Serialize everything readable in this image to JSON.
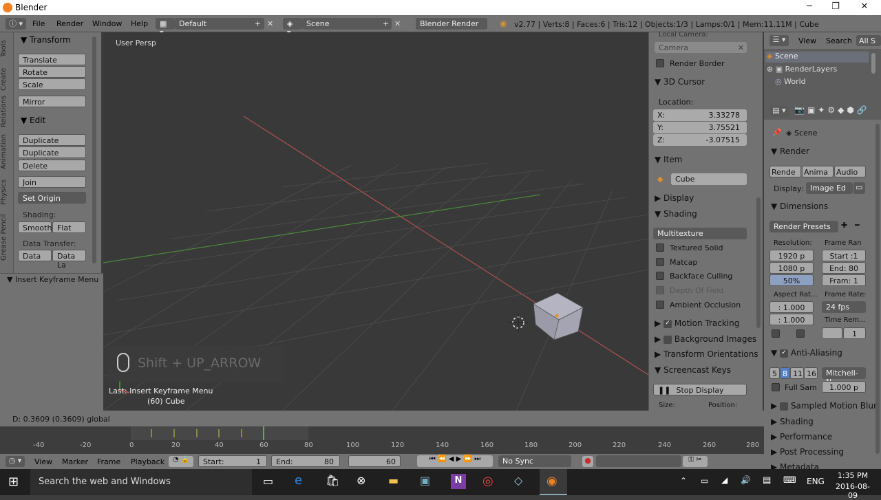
{
  "window": {
    "title": "Blender",
    "minimize": "─",
    "restore": "❐",
    "close": "✕"
  },
  "topbar": {
    "menus": [
      "File",
      "Render",
      "Window",
      "Help"
    ],
    "layout": "Default",
    "scene": "Scene",
    "engine": "Blender Render",
    "stats": "v2.77 | Verts:8 | Faces:6 | Tris:12 | Objects:1/3 | Lamps:0/1 | Mem:11.11M | Cube"
  },
  "vtabs": [
    "Tools",
    "Create",
    "Relations",
    "Animation",
    "Physics",
    "Grease Pencil"
  ],
  "tool": {
    "transform": "Transform",
    "translate": "Translate",
    "rotate": "Rotate",
    "scale": "Scale",
    "mirror": "Mirror",
    "edit": "Edit",
    "duplicate": "Duplicate",
    "duplicate_linked": "Duplicate Linked",
    "delete": "Delete",
    "join": "Join",
    "set_origin": "Set Origin",
    "shading": "Shading:",
    "smooth": "Smooth",
    "flat": "Flat",
    "data_transfer": "Data Transfer:",
    "data": "Data",
    "data_la": "Data La"
  },
  "redo": {
    "title": "Insert Keyframe Menu"
  },
  "viewport": {
    "persp": "User Persp",
    "screencast": "Shift + UP_ARROW",
    "last_op": "Last: Insert Keyframe Menu",
    "object": "(60) Cube"
  },
  "npanel": {
    "local_camera": "Local Camera:",
    "camera": "Camera",
    "render_border": "Render Border",
    "cursor": "3D Cursor",
    "location": "Location:",
    "x_label": "X:",
    "x": "3.33278",
    "y_label": "Y:",
    "y": "3.75521",
    "z_label": "Z:",
    "z": "-3.07515",
    "item": "Item",
    "item_name": "Cube",
    "display": "Display",
    "shading": "Shading",
    "shading_mode": "Multitexture",
    "textured_solid": "Textured Solid",
    "matcap": "Matcap",
    "backface": "Backface Culling",
    "dof": "Depth Of Field",
    "ao": "Ambient Occlusion",
    "motion_tracking": "Motion Tracking",
    "background_images": "Background Images",
    "transform_orientations": "Transform Orientations",
    "screencast_keys": "Screencast Keys",
    "stop_display": "Stop Display",
    "size": "Size:",
    "position": "Position:"
  },
  "outliner": {
    "view": "View",
    "search": "Search",
    "all": "All S",
    "items": [
      "Scene",
      "RenderLayers",
      "World"
    ]
  },
  "props": {
    "scene": "Scene",
    "render": "Render",
    "render_btns": [
      "Rende",
      "Anima",
      "Audio"
    ],
    "display_label": "Display:",
    "display_val": "Image Ed",
    "dimensions": "Dimensions",
    "presets": "Render Presets",
    "resolution": "Resolution:",
    "res_x": "1920 p",
    "res_y": "1080 p",
    "res_pct": "50%",
    "frame_range": "Frame Ran",
    "start": "Start :1",
    "end": "End: 80",
    "frame_step": "Fram: 1",
    "aspect": "Aspect Rat...",
    "aspect_x": ": 1.000",
    "aspect_y": ": 1.000",
    "frame_rate": "Frame Rate:",
    "fps": "24 fps",
    "time_remap": "Time Rem...",
    "remap_val": "1",
    "anti_aliasing": "Anti-Aliasing",
    "aa_samples": [
      "5",
      "8",
      "11",
      "16"
    ],
    "aa_filter": "Mitchell-N",
    "full_sample": "Full Sam",
    "filter_size": "1.000 p",
    "sampled_motion": "Sampled Motion Blur",
    "shading": "Shading",
    "performance": "Performance",
    "post_processing": "Post Processing",
    "metadata": "Metadata"
  },
  "status": {
    "text": "D: 0.3609 (0.3609) global"
  },
  "timeline": {
    "ticks": [
      "-40",
      "-20",
      "0",
      "20",
      "40",
      "60",
      "80",
      "100",
      "120",
      "140",
      "160",
      "180",
      "200",
      "220",
      "240",
      "260",
      "280"
    ],
    "view": "View",
    "marker": "Marker",
    "frame": "Frame",
    "playback": "Playback",
    "start_label": "Start:",
    "start": "1",
    "end_label": "End:",
    "end": "80",
    "current": "60",
    "sync": "No Sync"
  },
  "taskbar": {
    "search": "Search the web and Windows",
    "lang": "ENG",
    "time": "1:35 PM",
    "date": "2016-08-09"
  },
  "colors": {
    "accent": "#5680c2",
    "x_axis": "#b05050",
    "y_axis": "#4c8a3a",
    "cube": "#aaaab8"
  }
}
